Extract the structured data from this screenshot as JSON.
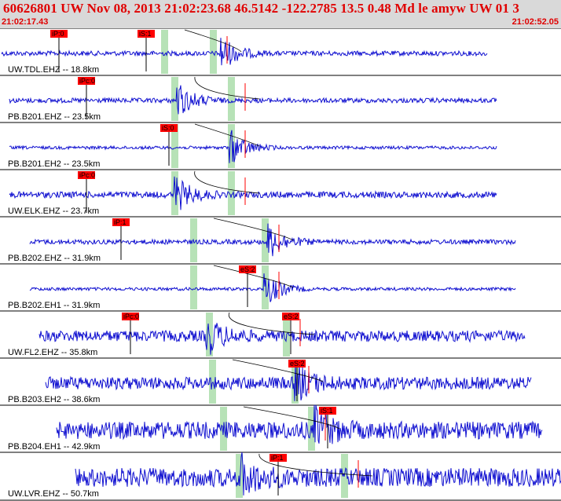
{
  "header": {
    "title": "60626801 UW Nov 08, 2013 21:02:23.68    46.5142 -122.2785 13.5 0.48 Md le amyw UW 01   3",
    "start_time": "21:02:17.43",
    "end_time": "21:02:52.05"
  },
  "colors": {
    "trace": "#1010d0",
    "pick_box": "#ff0000",
    "pick_band": "#b7e2b7",
    "header_bg": "#d9d9d9",
    "header_text": "#e00000"
  },
  "traces": [
    {
      "label": "UW.TDL.EHZ -- 18.8km",
      "picks": [
        {
          "text": "iP:0",
          "at": 0.1
        },
        {
          "text": "iS:1",
          "at": 0.28
        }
      ]
    },
    {
      "label": "PB.B201.EHZ -- 23.5km",
      "picks": [
        {
          "text": "iPc:0",
          "at": 0.14
        }
      ]
    },
    {
      "label": "PB.B201.EH2 -- 23.5km",
      "picks": [
        {
          "text": "iS:0",
          "at": 0.31
        }
      ]
    },
    {
      "label": "UW.ELK.EHZ -- 23.7km",
      "picks": [
        {
          "text": "iPc:0",
          "at": 0.14
        }
      ]
    },
    {
      "label": "PB.B202.EHZ -- 31.9km",
      "picks": [
        {
          "text": "iP:1",
          "at": 0.17
        }
      ]
    },
    {
      "label": "PB.B202.EH1 -- 31.9km",
      "picks": [
        {
          "text": "eS:2",
          "at": 0.43
        }
      ]
    },
    {
      "label": "UW.FL2.EHZ -- 35.8km",
      "picks": [
        {
          "text": "iPc:0",
          "at": 0.17
        },
        {
          "text": "eS:2",
          "at": 0.5
        }
      ]
    },
    {
      "label": "PB.B203.EH2 -- 38.6km",
      "picks": [
        {
          "text": "eS:2",
          "at": 0.5
        }
      ]
    },
    {
      "label": "PB.B204.EH1 -- 42.9km",
      "picks": [
        {
          "text": "iS:1",
          "at": 0.54
        }
      ]
    },
    {
      "label": "UW.LVR.EHZ -- 50.7km",
      "picks": [
        {
          "text": "iP:1",
          "at": 0.4
        }
      ]
    }
  ]
}
